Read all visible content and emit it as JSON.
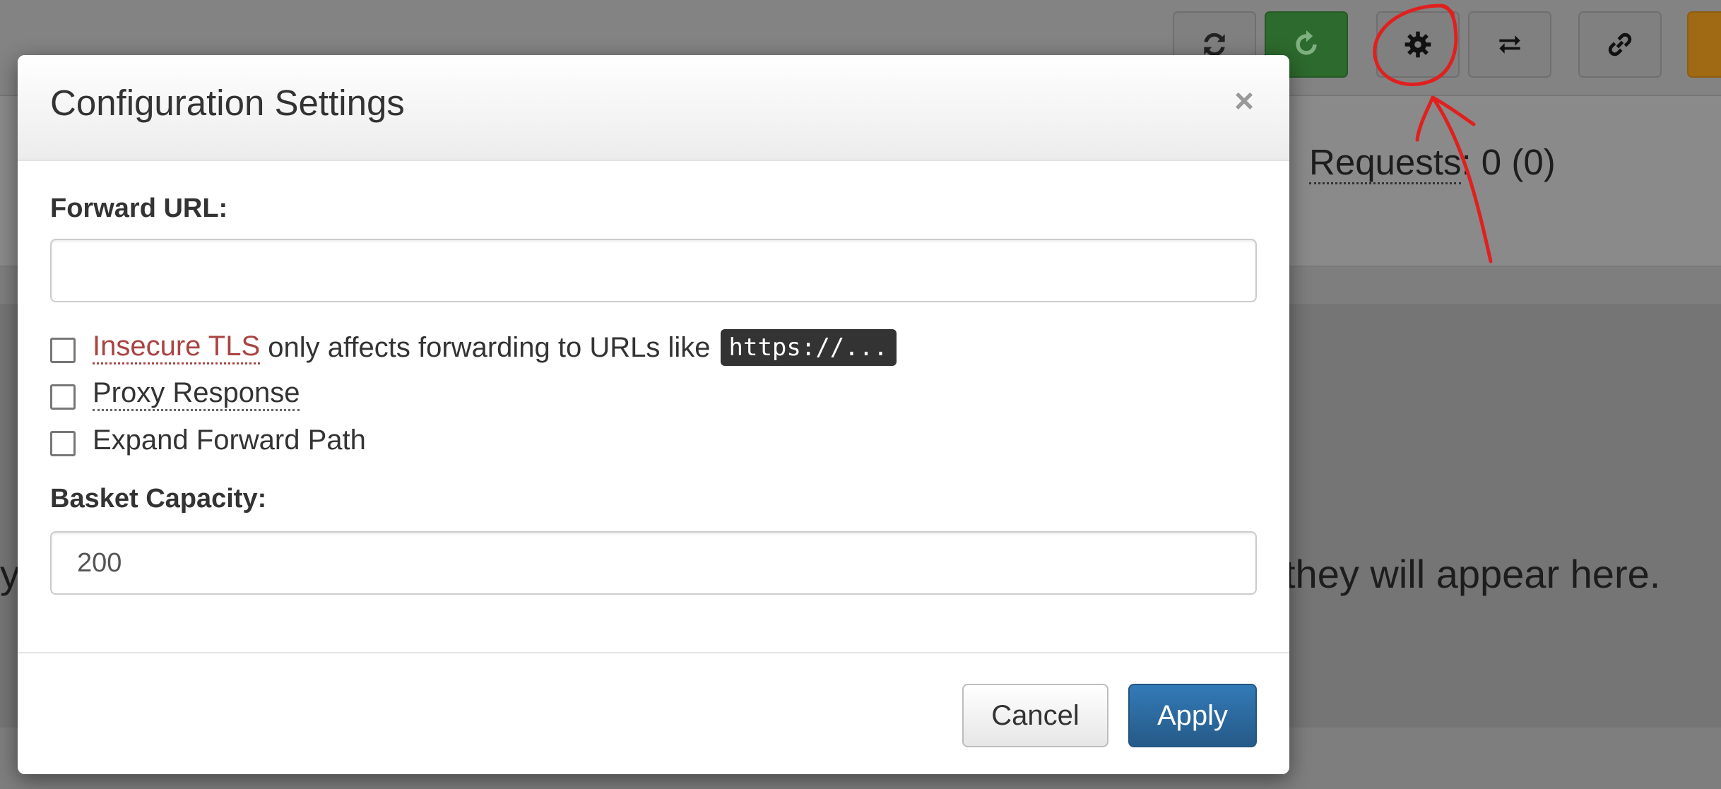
{
  "background": {
    "toolbar_icons": [
      "refresh-icon",
      "reload-icon",
      "gear-icon",
      "exchange-icon",
      "link-icon",
      "more-icon"
    ],
    "requests_label": "Requests",
    "requests_count": ": 0 (0)",
    "empty_message_fragment": "they will appear here.",
    "empty_message_left_fragment": "y,",
    "colors": {
      "green_button": "#2d6a2d",
      "orange_button": "#a06a14",
      "annotation": "#e0201f"
    }
  },
  "modal": {
    "title": "Configuration Settings",
    "close_label": "×",
    "forward_url": {
      "label": "Forward URL:",
      "value": "",
      "placeholder": ""
    },
    "checkboxes": [
      {
        "label_link": "Insecure TLS",
        "suffix": " only affects forwarding to URLs like",
        "code": "https://...",
        "checked": false
      },
      {
        "label": "Proxy Response",
        "checked": false
      },
      {
        "label": "Expand Forward Path",
        "checked": false
      }
    ],
    "basket_capacity": {
      "label": "Basket Capacity:",
      "value": "200"
    },
    "buttons": {
      "cancel": "Cancel",
      "apply": "Apply"
    },
    "colors": {
      "apply": "#337ab7",
      "insecure_link": "#a94442"
    }
  }
}
